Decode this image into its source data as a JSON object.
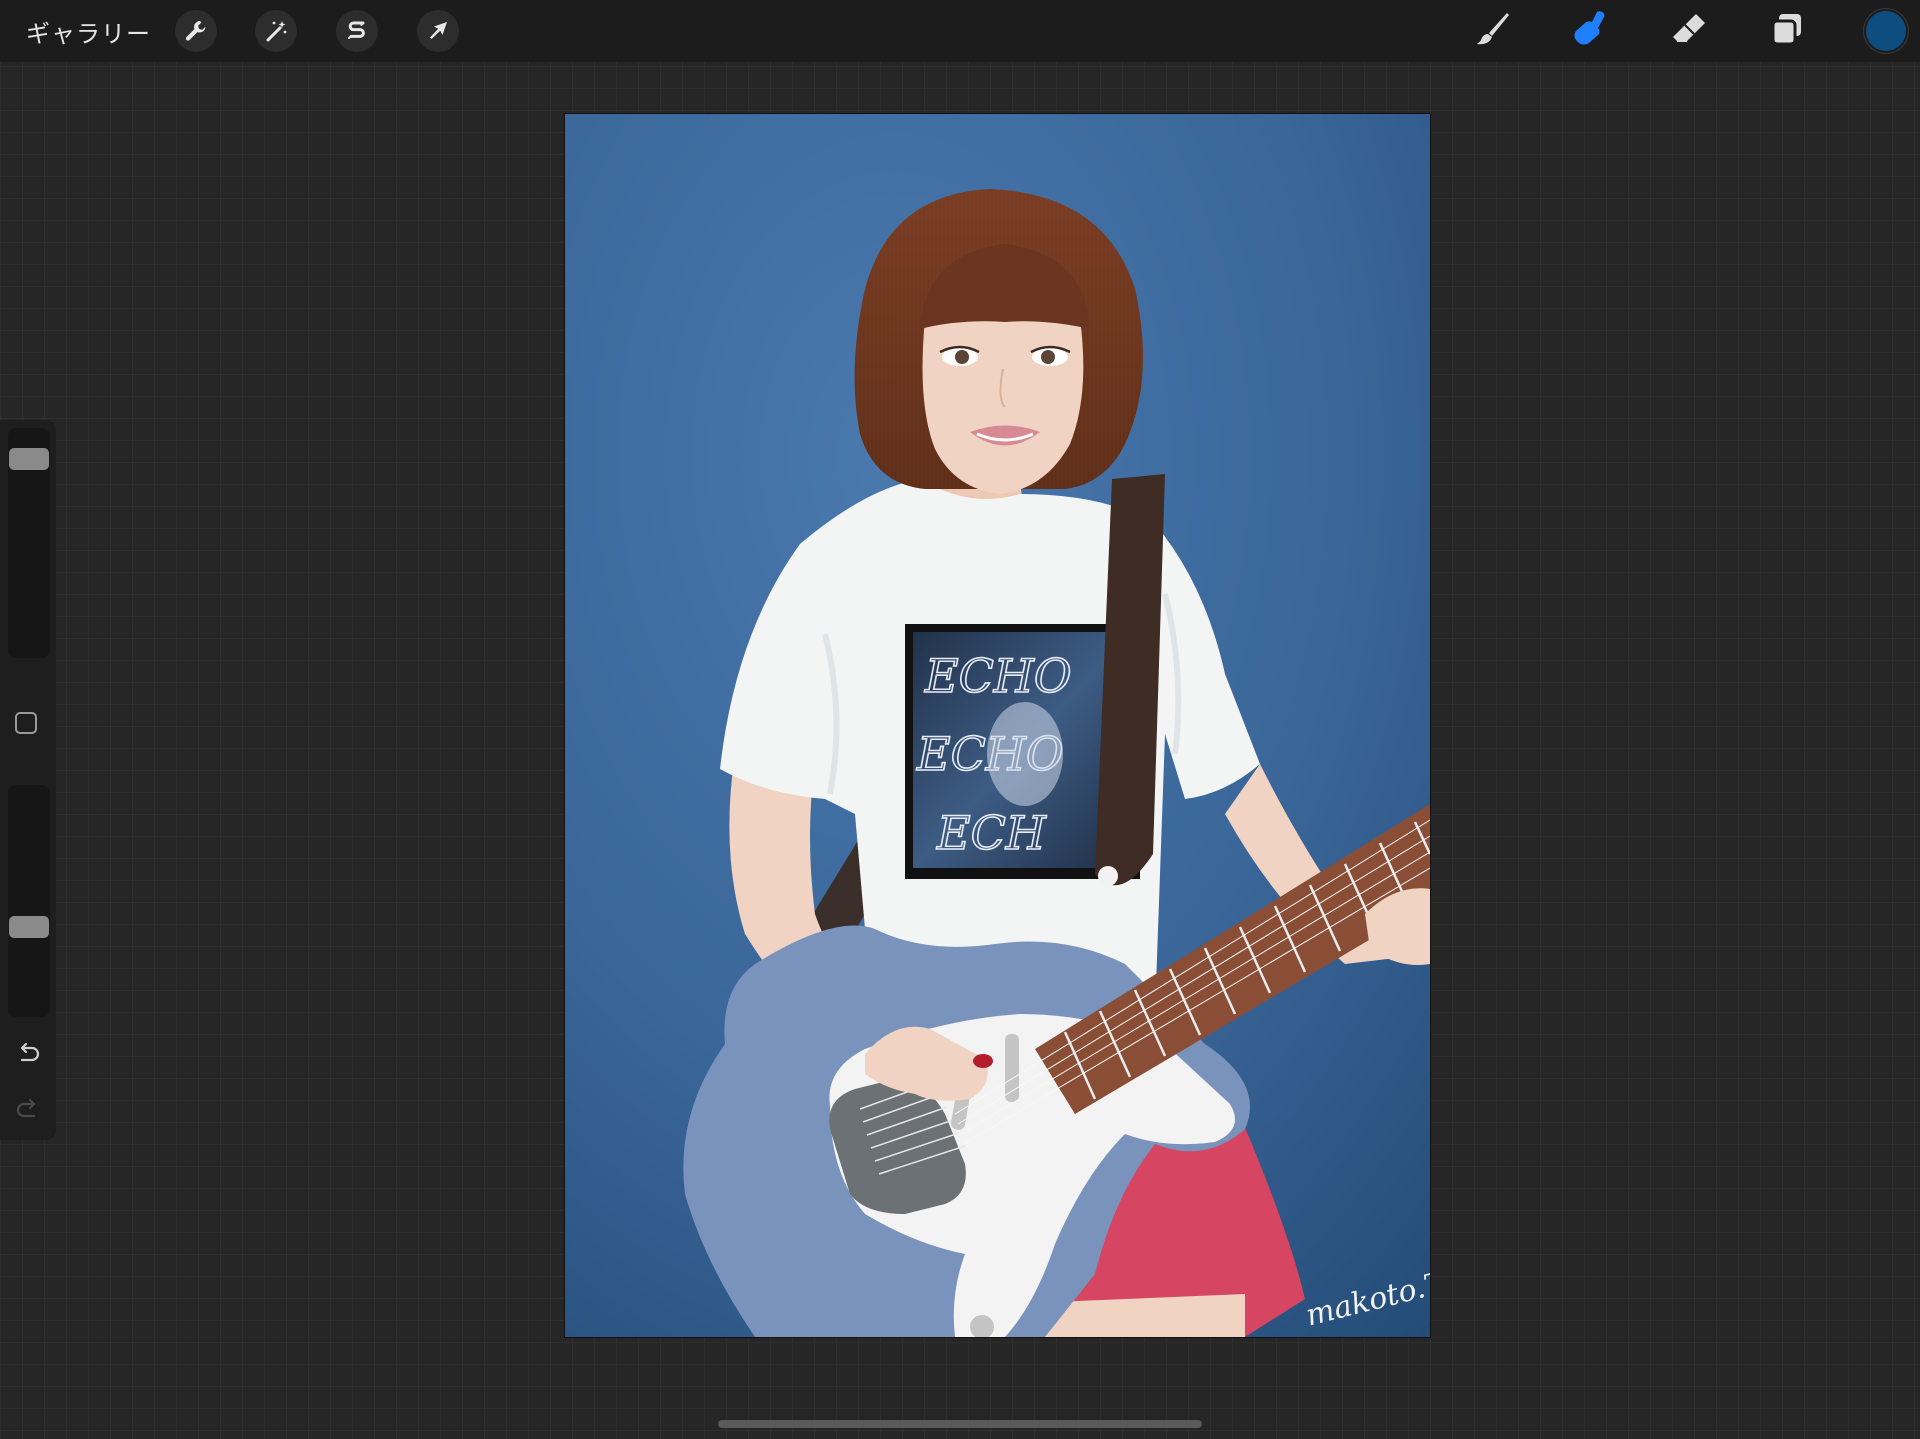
{
  "toolbar": {
    "gallery_label": "ギャラリー",
    "left_tools": [
      {
        "name": "actions",
        "icon": "wrench-icon"
      },
      {
        "name": "adjustments",
        "icon": "magic-wand-icon"
      },
      {
        "name": "selection",
        "icon": "selection-s-icon"
      },
      {
        "name": "transform",
        "icon": "arrow-cursor-icon"
      }
    ],
    "right_tools": [
      {
        "name": "brush",
        "icon": "brush-icon",
        "active": false
      },
      {
        "name": "smudge",
        "icon": "smudge-finger-icon",
        "active": true
      },
      {
        "name": "eraser",
        "icon": "eraser-icon",
        "active": false
      },
      {
        "name": "layers",
        "icon": "layers-icon",
        "active": false
      }
    ],
    "current_color": "#0e4d7f",
    "active_tool_color": "#1e7fff"
  },
  "sidebar": {
    "brush_size_level": 0.08,
    "brush_opacity_level": 0.63,
    "modify_icon": "square-modify-icon",
    "undo_icon": "undo-icon",
    "redo_icon": "redo-icon",
    "redo_enabled": false
  },
  "canvas": {
    "signature": "makoto.T",
    "shirt_print_text": [
      "ECHO",
      "ECHO",
      "ECH"
    ],
    "background_color": "#3a6699",
    "hair_color": "#6b3520",
    "shirt_color": "#f4f4f2",
    "guitar_body_color": "#7a93bc",
    "skirt_color": "#d64562"
  }
}
